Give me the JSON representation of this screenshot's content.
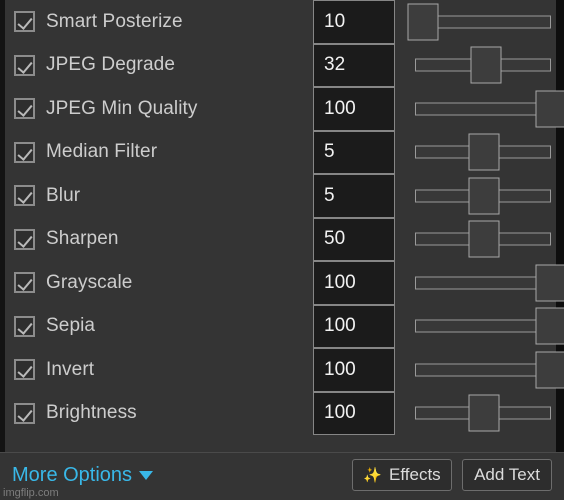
{
  "effects": [
    {
      "label": "Smart Posterize",
      "checked": true,
      "value": "10",
      "slider_pct": 6
    },
    {
      "label": "JPEG Degrade",
      "checked": true,
      "value": "32",
      "slider_pct": 52
    },
    {
      "label": "JPEG Min Quality",
      "checked": true,
      "value": "100",
      "slider_pct": 100
    },
    {
      "label": "Median Filter",
      "checked": true,
      "value": "5",
      "slider_pct": 51
    },
    {
      "label": "Blur",
      "checked": true,
      "value": "5",
      "slider_pct": 51
    },
    {
      "label": "Sharpen",
      "checked": true,
      "value": "50",
      "slider_pct": 51
    },
    {
      "label": "Grayscale",
      "checked": true,
      "value": "100",
      "slider_pct": 100
    },
    {
      "label": "Sepia",
      "checked": true,
      "value": "100",
      "slider_pct": 100
    },
    {
      "label": "Invert",
      "checked": true,
      "value": "100",
      "slider_pct": 100
    },
    {
      "label": "Brightness",
      "checked": true,
      "value": "100",
      "slider_pct": 51
    }
  ],
  "bottom_bar": {
    "more_options_label": "More Options",
    "more_options_caret": "caret-down-icon",
    "effects_button_label": "Effects",
    "effects_button_icon": "sparkles-icon",
    "effects_button_glyph": "✨",
    "add_text_button_label": "Add Text"
  },
  "watermark": "imgflip.com",
  "colors": {
    "background": "#343434",
    "accent_link": "#39b8e8",
    "label_text": "#cdcdcd",
    "value_text": "#f2f2f2",
    "value_box_bg": "#1b1b1b",
    "control_border": "#9a9a9a",
    "sparkle_gold": "#f0b429"
  }
}
